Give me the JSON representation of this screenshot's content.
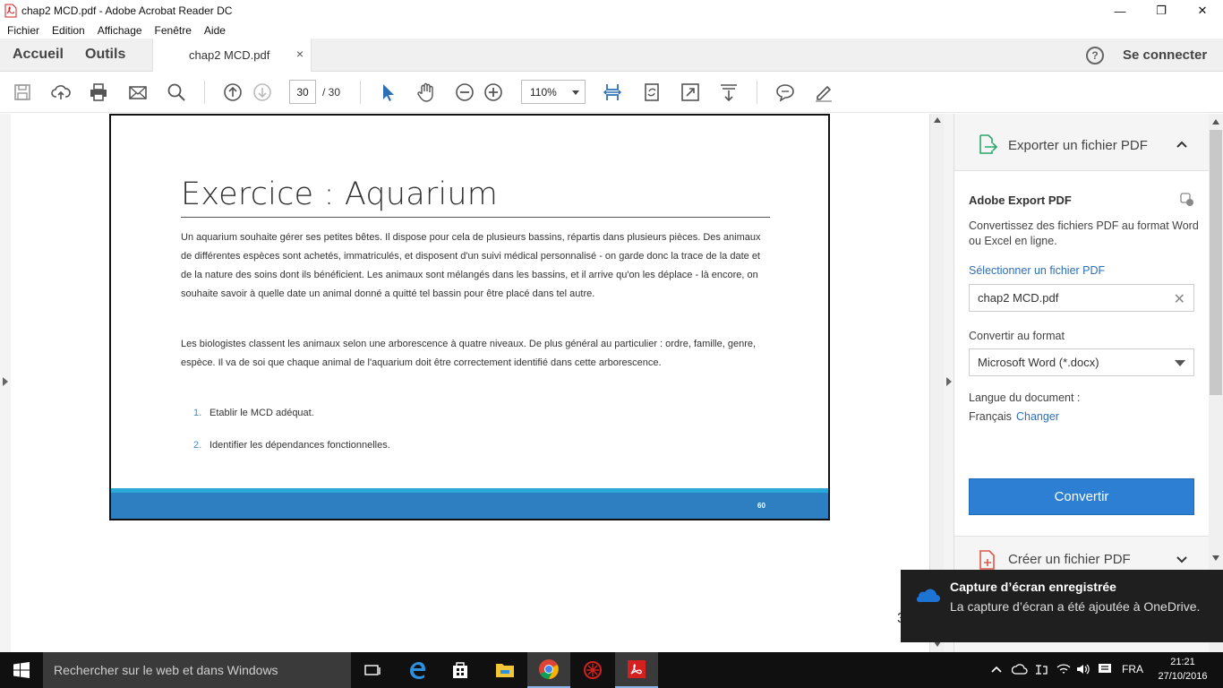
{
  "window": {
    "title": "chap2 MCD.pdf - Adobe Acrobat Reader DC",
    "minimize": "—",
    "maximize": "❐",
    "close": "✕"
  },
  "menu": [
    "Fichier",
    "Edition",
    "Affichage",
    "Fenêtre",
    "Aide"
  ],
  "tabs": {
    "home": "Accueil",
    "tools": "Outils",
    "document": "chap2 MCD.pdf",
    "close": "×",
    "help": "?",
    "signin": "Se connecter"
  },
  "toolbar": {
    "page_current": "30",
    "page_total": "/ 30",
    "zoom": "110%",
    "icons": [
      "save-icon",
      "cloud-upload-icon",
      "print-icon",
      "mail-icon",
      "search-icon",
      "page-up-icon",
      "page-down-icon",
      "select-cursor-icon",
      "hand-icon",
      "zoom-out-icon",
      "zoom-in-icon",
      "fit-page-icon",
      "rotate-icon",
      "fullscreen-icon",
      "scroll-mode-icon",
      "comment-icon",
      "sign-icon"
    ]
  },
  "document": {
    "heading": "Exercice  : Aquarium",
    "paragraph1": "Un aquarium souhaite gérer ses petites bêtes. Il dispose pour cela de plusieurs bassins, répartis dans plusieurs pièces. Des animaux de différentes espèces sont achetés, immatriculés, et disposent d'un suivi médical personnalisé - on garde donc la trace de la date et de la nature des soins dont ils bénéficient. Les animaux sont mélangés dans les bassins, et il arrive qu'on les déplace - là encore, on souhaite savoir à quelle date un animal donné a quitté tel bassin pour être placé dans tel autre.",
    "paragraph2": "Les biologistes classent les animaux selon une arborescence à quatre niveaux. De plus général au particulier : ordre, famille, genre, espèce. Il va de soi que chaque animal de l'aquarium doit être correctement identifié dans cette arborescence.",
    "items": [
      {
        "num": "1.",
        "text": "Etablir le MCD adéquat."
      },
      {
        "num": "2.",
        "text": "Identifier les dépendances fonctionnelles."
      }
    ],
    "page_number": "60"
  },
  "right_panel": {
    "export_header": "Exporter un fichier PDF",
    "section_title": "Adobe Export PDF",
    "description": "Convertissez des fichiers PDF au format Word ou Excel en ligne.",
    "select_file_link": "Sélectionner un fichier PDF",
    "selected_file": "chap2 MCD.pdf",
    "convert_to_label": "Convertir au format",
    "format_value": "Microsoft Word (*.docx)",
    "language_label": "Langue du document :",
    "language_value": "Français",
    "language_change": "Changer",
    "convert_button": "Convertir",
    "create_header": "Créer un fichier PDF"
  },
  "toast": {
    "title": "Capture d’écran enregistrée",
    "message": "La capture d’écran a été ajoutée à OneDrive."
  },
  "partial_text": "3",
  "taskbar": {
    "search_placeholder": "Rechercher sur le web et dans Windows",
    "language": "FRA",
    "time": "21:21",
    "date": "27/10/2016"
  },
  "colors": {
    "accent_blue": "#2d7fd4",
    "link_blue": "#2d6fb7",
    "slide_band": "#2d7fc1",
    "slide_band_light": "#2aa8d8",
    "acrobat_red": "#d4201f"
  }
}
